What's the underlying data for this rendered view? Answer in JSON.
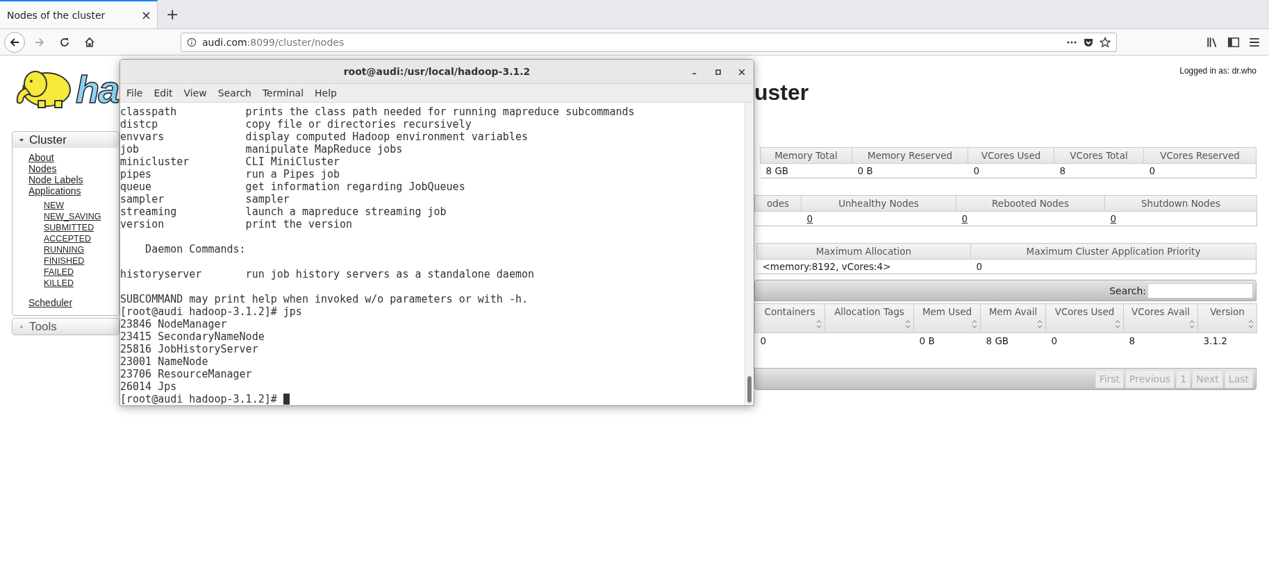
{
  "browser": {
    "tab": {
      "title": "Nodes of the cluster",
      "selected": true,
      "close": "×"
    },
    "new_tab": "+",
    "url": {
      "host": "audi.com",
      "path": ":8099/cluster/nodes"
    },
    "back_enabled": true,
    "forward_enabled": false
  },
  "page": {
    "logo_text": "ha",
    "logged_in": "Logged in as: dr.who",
    "title": "uster",
    "sidebar": [
      {
        "label": "Cluster",
        "expanded": true,
        "children": [
          {
            "label": "About"
          },
          {
            "label": "Nodes"
          },
          {
            "label": "Node Labels"
          },
          {
            "label": "Applications",
            "children": [
              {
                "label": "NEW"
              },
              {
                "label": "NEW_SAVING"
              },
              {
                "label": "SUBMITTED"
              },
              {
                "label": "ACCEPTED"
              },
              {
                "label": "RUNNING"
              },
              {
                "label": "FINISHED"
              },
              {
                "label": "FAILED"
              },
              {
                "label": "KILLED"
              }
            ]
          },
          {
            "label": "Scheduler"
          }
        ]
      },
      {
        "label": "Tools",
        "expanded": false
      }
    ],
    "metrics_tables": [
      {
        "columns": [
          "Memory Total",
          "Memory Reserved",
          "VCores Used",
          "VCores Total",
          "VCores Reserved"
        ],
        "rows": [
          [
            {
              "text": "8 GB",
              "link": false
            },
            {
              "text": "0 B",
              "link": false
            },
            {
              "text": "0",
              "link": false
            },
            {
              "text": "8",
              "link": false
            },
            {
              "text": "0",
              "link": false
            }
          ]
        ]
      },
      {
        "columns": [
          "odes",
          "Unhealthy Nodes",
          "Rebooted Nodes",
          "Shutdown Nodes"
        ],
        "rows": [
          [
            null,
            {
              "text": "0",
              "link": true
            },
            {
              "text": "0",
              "link": true
            },
            {
              "text": "0",
              "link": true
            }
          ]
        ]
      },
      {
        "columns": [
          "Maximum Allocation",
          "Maximum Cluster Application Priority"
        ],
        "rows": [
          [
            {
              "text": "<memory:8192, vCores:4>",
              "link": false
            },
            {
              "text": "0",
              "link": false
            }
          ]
        ]
      }
    ],
    "nodes_table": {
      "search_label": "Search:",
      "columns": [
        "Containers",
        "Allocation Tags",
        "Mem Used",
        "Mem Avail",
        "VCores Used",
        "VCores Avail",
        "Version"
      ],
      "rows": [
        [
          "0",
          null,
          "0 B",
          "8 GB",
          "0",
          "8",
          "3.1.2"
        ]
      ],
      "pager": [
        {
          "label": "First",
          "disabled": true
        },
        {
          "label": "Previous",
          "disabled": true
        },
        {
          "label": "1",
          "disabled": true
        },
        {
          "label": "Next",
          "disabled": true
        },
        {
          "label": "Last",
          "disabled": true
        }
      ]
    }
  },
  "terminal": {
    "title": "root@audi:/usr/local/hadoop-3.1.2",
    "menu": [
      "File",
      "Edit",
      "View",
      "Search",
      "Terminal",
      "Help"
    ],
    "lines": [
      {
        "kind": "command",
        "name": "classpath",
        "description": "prints the class path needed for running mapreduce subcommands"
      },
      {
        "kind": "command",
        "name": "distcp",
        "description": "copy file or directories recursively"
      },
      {
        "kind": "command",
        "name": "envvars",
        "description": "display computed Hadoop environment variables"
      },
      {
        "kind": "command",
        "name": "job",
        "description": "manipulate MapReduce jobs"
      },
      {
        "kind": "command",
        "name": "minicluster",
        "description": "CLI MiniCluster"
      },
      {
        "kind": "command",
        "name": "pipes",
        "description": "run a Pipes job"
      },
      {
        "kind": "command",
        "name": "queue",
        "description": "get information regarding JobQueues"
      },
      {
        "kind": "command",
        "name": "sampler",
        "description": "sampler"
      },
      {
        "kind": "command",
        "name": "streaming",
        "description": "launch a mapreduce streaming job"
      },
      {
        "kind": "command",
        "name": "version",
        "description": "print the version"
      },
      {
        "kind": "blank"
      },
      {
        "kind": "heading",
        "text": "Daemon Commands:"
      },
      {
        "kind": "blank"
      },
      {
        "kind": "command",
        "name": "historyserver",
        "description": "run job history servers as a standalone daemon"
      },
      {
        "kind": "blank"
      },
      {
        "kind": "text",
        "text": "SUBCOMMAND may print help when invoked w/o parameters or with -h.",
        "cursor": false
      },
      {
        "kind": "text",
        "text": "[root@audi hadoop-3.1.2]# jps",
        "cursor": false
      },
      {
        "kind": "text",
        "text": "23846 NodeManager",
        "cursor": false
      },
      {
        "kind": "text",
        "text": "23415 SecondaryNameNode",
        "cursor": false
      },
      {
        "kind": "text",
        "text": "25816 JobHistoryServer",
        "cursor": false
      },
      {
        "kind": "text",
        "text": "23001 NameNode",
        "cursor": false
      },
      {
        "kind": "text",
        "text": "23706 ResourceManager",
        "cursor": false
      },
      {
        "kind": "text",
        "text": "26014 Jps",
        "cursor": false
      },
      {
        "kind": "text",
        "text": "[root@audi hadoop-3.1.2]#",
        "cursor": true
      }
    ]
  }
}
